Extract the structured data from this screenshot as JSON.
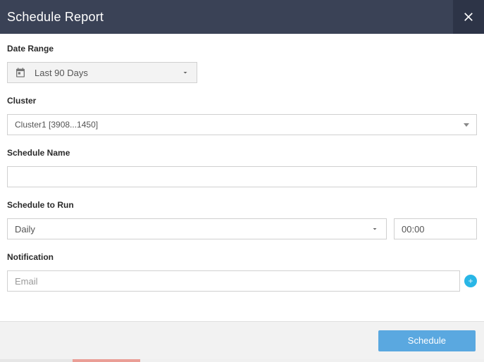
{
  "modal": {
    "title": "Schedule Report"
  },
  "labels": {
    "dateRange": "Date Range",
    "cluster": "Cluster",
    "scheduleName": "Schedule Name",
    "scheduleToRun": "Schedule to Run",
    "notification": "Notification"
  },
  "fields": {
    "dateRangeValue": "Last 90 Days",
    "clusterValue": "Cluster1 [3908...1450]",
    "scheduleNameValue": "",
    "frequencyValue": "Daily",
    "timeValue": "00:00",
    "notificationPlaceholder": "Email",
    "notificationValue": ""
  },
  "buttons": {
    "schedule": "Schedule"
  }
}
